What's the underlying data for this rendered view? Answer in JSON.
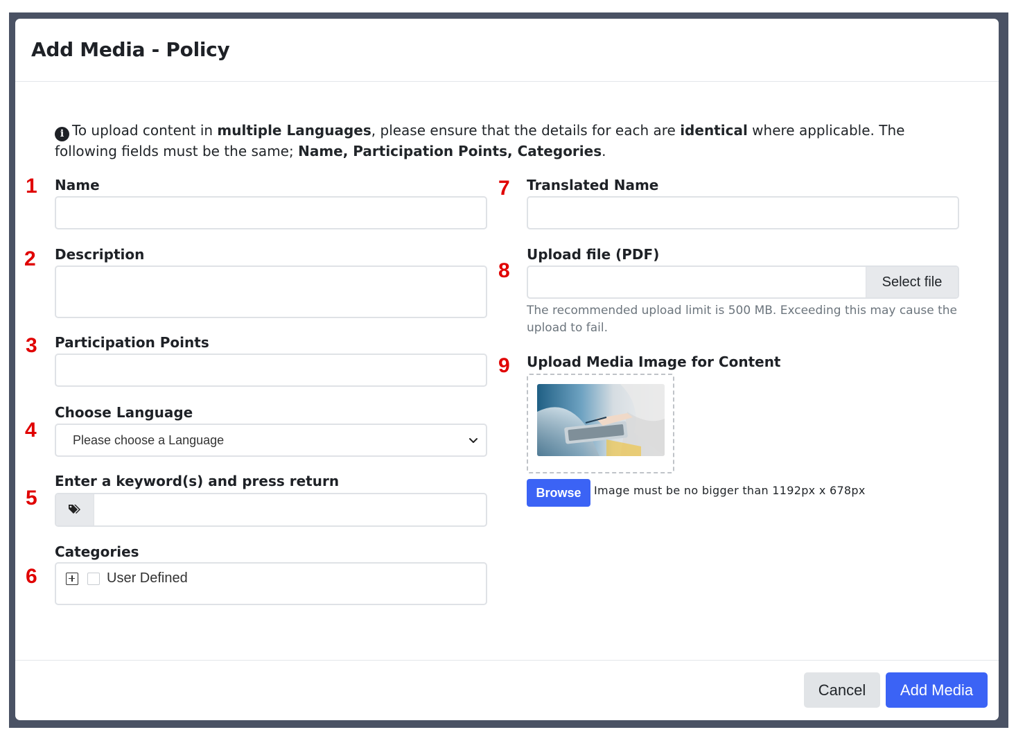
{
  "modal": {
    "title": "Add Media - Policy"
  },
  "notice": {
    "t1": "To upload content in ",
    "b1": "multiple Languages",
    "t2": ", please ensure that the details for each are ",
    "b2": "identical",
    "t3": " where applicable. The following fields must be the same; ",
    "b3": "Name, Participation Points, Categories",
    "t4": "."
  },
  "markers": [
    "1",
    "2",
    "3",
    "4",
    "5",
    "6",
    "7",
    "8",
    "9"
  ],
  "fields": {
    "name": {
      "label": "Name",
      "value": ""
    },
    "description": {
      "label": "Description",
      "value": ""
    },
    "participation_points": {
      "label": "Participation Points",
      "value": ""
    },
    "language": {
      "label": "Choose Language",
      "selected": "Please choose a Language"
    },
    "keywords": {
      "label": "Enter a keyword(s) and press return",
      "icon": "tags-icon",
      "value": ""
    },
    "categories": {
      "label": "Categories",
      "items": [
        {
          "label": "User Defined",
          "checked": false,
          "expanded": false
        }
      ]
    },
    "translated_name": {
      "label": "Translated Name",
      "value": ""
    },
    "upload_file": {
      "label": "Upload file (PDF)",
      "button": "Select file",
      "help": "The recommended upload limit is 500 MB. Exceeding this may cause the upload to fail."
    },
    "media_image": {
      "label": "Upload Media Image for Content",
      "browse": "Browse",
      "note": "Image must be no bigger than 1192px x 678px"
    }
  },
  "footer": {
    "cancel": "Cancel",
    "submit": "Add Media"
  },
  "colors": {
    "primary": "#3b63f5",
    "marker": "#e00000",
    "backdrop": "#4a5264"
  }
}
